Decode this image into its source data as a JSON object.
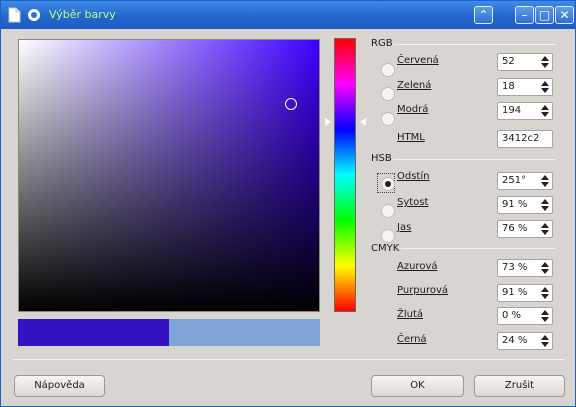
{
  "window": {
    "title": "Výběr barvy",
    "buttons": {
      "minimize": "–",
      "maximize": "□",
      "close": "✕",
      "shade": "⌃"
    }
  },
  "colors": {
    "new": "#3412c2",
    "previous": "#7fa5d6"
  },
  "rgb": {
    "title": "RGB",
    "red": {
      "label": "Červená",
      "value": "52"
    },
    "green": {
      "label": "Zelená",
      "value": "18"
    },
    "blue": {
      "label": "Modrá",
      "value": "194"
    },
    "html": {
      "label": "HTML",
      "value": "3412c2"
    }
  },
  "hsb": {
    "title": "HSB",
    "hue": {
      "label": "Odstín",
      "value": "251°"
    },
    "saturation": {
      "label": "Sytost",
      "value": "91 %"
    },
    "brightness": {
      "label": "Jas",
      "value": "76 %"
    }
  },
  "cmyk": {
    "title": "CMYK",
    "cyan": {
      "label": "Azurová",
      "value": "73 %"
    },
    "magenta": {
      "label": "Purpurová",
      "value": "91 %"
    },
    "yellow": {
      "label": "Žlutá",
      "value": "0 %"
    },
    "black": {
      "label": "Černá",
      "value": "24 %"
    }
  },
  "selected_mode": "hue",
  "footer": {
    "help": "Nápověda",
    "ok": "OK",
    "cancel": "Zrušit"
  }
}
